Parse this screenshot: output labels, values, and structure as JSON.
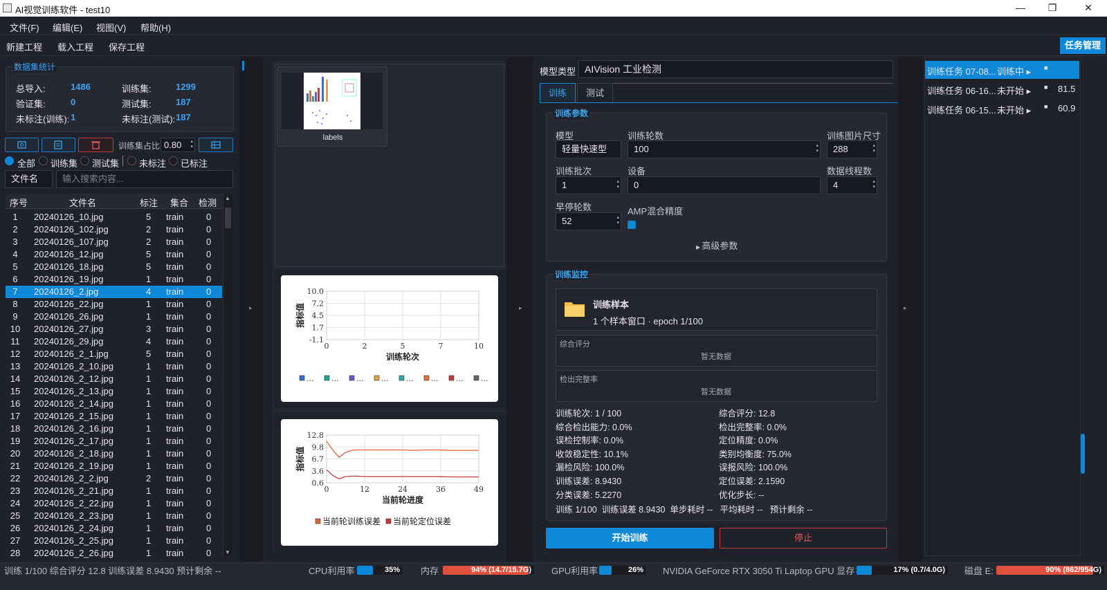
{
  "window": {
    "title": "AI视觉训练软件 - test10",
    "minimize": "—",
    "maximize": "❐",
    "close": "✕"
  },
  "menu": [
    "文件(F)",
    "编辑(E)",
    "视图(V)",
    "帮助(H)"
  ],
  "toolbar": {
    "new": "新建工程",
    "load": "载入工程",
    "save": "保存工程",
    "task_manage": "任务管理"
  },
  "dataset": {
    "title": "数据集统计",
    "total_label": "总导入:",
    "total": "1486",
    "train_label": "训练集:",
    "train": "1299",
    "val_label": "验证集:",
    "val": "0",
    "test_label": "测试集:",
    "test": "187",
    "unlabeled_train_label": "未标注(训练):",
    "unlabeled_train": "1",
    "unlabeled_test_label": "未标注(测试):",
    "unlabeled_test": "187"
  },
  "split": {
    "label": "训练集占比",
    "value": "0.80"
  },
  "filters": [
    "全部",
    "训练集",
    "测试集",
    "未标注",
    "已标注"
  ],
  "search": {
    "field": "文件名",
    "placeholder": "输入搜索内容..."
  },
  "table": {
    "headers": [
      "序号",
      "文件名",
      "标注",
      "集合",
      "检测"
    ],
    "rows": [
      [
        "1",
        "20240126_10.jpg",
        "5",
        "train",
        "0"
      ],
      [
        "2",
        "20240126_102.jpg",
        "2",
        "train",
        "0"
      ],
      [
        "3",
        "20240126_107.jpg",
        "2",
        "train",
        "0"
      ],
      [
        "4",
        "20240126_12.jpg",
        "5",
        "train",
        "0"
      ],
      [
        "5",
        "20240126_18.jpg",
        "5",
        "train",
        "0"
      ],
      [
        "6",
        "20240126_19.jpg",
        "1",
        "train",
        "0"
      ],
      [
        "7",
        "20240126_2.jpg",
        "4",
        "train",
        "0"
      ],
      [
        "8",
        "20240126_22.jpg",
        "1",
        "train",
        "0"
      ],
      [
        "9",
        "20240126_26.jpg",
        "1",
        "train",
        "0"
      ],
      [
        "10",
        "20240126_27.jpg",
        "3",
        "train",
        "0"
      ],
      [
        "11",
        "20240126_29.jpg",
        "4",
        "train",
        "0"
      ],
      [
        "12",
        "20240126_2_1.jpg",
        "5",
        "train",
        "0"
      ],
      [
        "13",
        "20240126_2_10.jpg",
        "1",
        "train",
        "0"
      ],
      [
        "14",
        "20240126_2_12.jpg",
        "1",
        "train",
        "0"
      ],
      [
        "15",
        "20240126_2_13.jpg",
        "1",
        "train",
        "0"
      ],
      [
        "16",
        "20240126_2_14.jpg",
        "1",
        "train",
        "0"
      ],
      [
        "17",
        "20240126_2_15.jpg",
        "1",
        "train",
        "0"
      ],
      [
        "18",
        "20240126_2_16.jpg",
        "1",
        "train",
        "0"
      ],
      [
        "19",
        "20240126_2_17.jpg",
        "1",
        "train",
        "0"
      ],
      [
        "20",
        "20240126_2_18.jpg",
        "1",
        "train",
        "0"
      ],
      [
        "21",
        "20240126_2_19.jpg",
        "1",
        "train",
        "0"
      ],
      [
        "22",
        "20240126_2_2.jpg",
        "2",
        "train",
        "0"
      ],
      [
        "23",
        "20240126_2_21.jpg",
        "1",
        "train",
        "0"
      ],
      [
        "24",
        "20240126_2_22.jpg",
        "1",
        "train",
        "0"
      ],
      [
        "25",
        "20240126_2_23.jpg",
        "1",
        "train",
        "0"
      ],
      [
        "26",
        "20240126_2_24.jpg",
        "1",
        "train",
        "0"
      ],
      [
        "27",
        "20240126_2_25.jpg",
        "1",
        "train",
        "0"
      ],
      [
        "28",
        "20240126_2_26.jpg",
        "1",
        "train",
        "0"
      ]
    ],
    "selected_index": 6
  },
  "thumbnail": {
    "label": "labels"
  },
  "chart_data": [
    {
      "type": "line",
      "title": "",
      "xlabel": "训练轮次",
      "ylabel": "指标值",
      "xlim": [
        0,
        10
      ],
      "ylim": [
        -1.1,
        10.0
      ],
      "x_ticks": [
        "0",
        "2",
        "5",
        "7",
        "10"
      ],
      "y_ticks": [
        "10.0",
        "7.2",
        "4.5",
        "1.7",
        "-1.1"
      ],
      "series": [],
      "legend_colors": [
        "#2f6fd6",
        "#1aa69a",
        "#6a5acd",
        "#e0a050",
        "#20b2aa",
        "#e0703a",
        "#c83a3a",
        "#666666"
      ],
      "legend_text": "...",
      "grid": true
    },
    {
      "type": "line",
      "title": "",
      "xlabel": "当前轮进度",
      "ylabel": "指标值",
      "xlim": [
        0,
        49
      ],
      "ylim": [
        0.6,
        12.8
      ],
      "x_ticks": [
        "0",
        "12",
        "24",
        "36",
        "49"
      ],
      "y_ticks": [
        "12.8",
        "9.8",
        "6.7",
        "3.6",
        "0.6"
      ],
      "series": [
        {
          "name": "当前轮训练误差",
          "color": "#e0633a",
          "x": [
            0,
            2,
            4,
            6,
            8,
            10,
            12,
            16,
            20,
            24,
            28,
            32,
            36,
            40,
            44,
            49
          ],
          "y": [
            11.2,
            9.0,
            7.1,
            8.3,
            8.9,
            9.0,
            9.0,
            9.0,
            9.0,
            9.0,
            8.9,
            9.0,
            9.0,
            8.9,
            8.9,
            8.9
          ]
        },
        {
          "name": "当前轮定位误差",
          "color": "#c83a3a",
          "x": [
            0,
            2,
            4,
            6,
            8,
            10,
            12,
            16,
            20,
            24,
            28,
            32,
            36,
            40,
            44,
            49
          ],
          "y": [
            3.9,
            2.5,
            1.6,
            2.2,
            2.3,
            2.3,
            2.2,
            2.2,
            2.2,
            2.2,
            2.2,
            2.2,
            2.2,
            2.1,
            2.1,
            2.1
          ]
        }
      ],
      "grid": true
    }
  ],
  "config": {
    "model_type_label": "模型类型",
    "model_type": "AIVision 工业检测",
    "tabs": [
      "训练",
      "测试"
    ],
    "params_title": "训练参数",
    "model_label": "模型",
    "model_value": "轻量快速型",
    "epochs_label": "训练轮数",
    "epochs_value": "100",
    "imgsz_label": "训练图片尺寸",
    "imgsz_value": "288",
    "batch_label": "训练批次",
    "batch_value": "1",
    "device_label": "设备",
    "device_value": "0",
    "workers_label": "数据线程数",
    "workers_value": "4",
    "patience_label": "早停轮数",
    "patience_value": "52",
    "amp_label": "AMP混合精度",
    "advanced": "高级参数"
  },
  "monitor": {
    "title": "训练监控",
    "sample_title": "训练样本",
    "sample_sub": "1 个样本窗口 · epoch 1/100",
    "score_label": "综合评分",
    "recall_label": "检出完整率",
    "no_data": "暂无数据",
    "metrics_left": [
      "训练轮次: 1 / 100",
      "综合检出能力: 0.0%",
      "误检控制率: 0.0%",
      "收敛稳定性: 10.1%",
      "漏检风险: 100.0%",
      "训练误差: 8.9430",
      "分类误差: 5.2270"
    ],
    "metrics_right": [
      "综合评分: 12.8",
      "检出完整率: 0.0%",
      "定位精度: 0.0%",
      "类别均衡度: 75.0%",
      "误报风险: 100.0%",
      "定位误差: 2.1590",
      "优化步长: --"
    ],
    "summary": "训练 1/100  训练误差 8.9430  单步耗时 --   平均耗时 --   预计剩余 --"
  },
  "buttons": {
    "start": "开始训练",
    "stop": "停止"
  },
  "tasks": [
    {
      "name": "训练任务 07-08...",
      "status": "训练中 ▸",
      "value": ""
    },
    {
      "name": "训练任务 06-16...",
      "status": "未开始 ▸",
      "value": "81.5"
    },
    {
      "name": "训练任务 06-15...",
      "status": "未开始 ▸",
      "value": "60.9"
    }
  ],
  "status": {
    "summary": "训练 1/100  综合评分 12.8  训练误差 8.9430  预计剩余 --",
    "cpu_label": "CPU利用率",
    "cpu": "35%",
    "cpu_frac": 0.35,
    "mem_label": "内存",
    "mem": "94% (14.7/15.7G)",
    "mem_frac": 0.94,
    "gpu_label": "GPU利用率",
    "gpu": "26%",
    "gpu_frac": 0.26,
    "gpu_name": "NVIDIA GeForce RTX 3050 Ti Laptop GPU 显存",
    "vram": "17% (0.7/4.0G)",
    "vram_frac": 0.17,
    "disk_label": "磁盘 E:",
    "disk": "90% (862/954G)",
    "disk_frac": 0.9
  }
}
